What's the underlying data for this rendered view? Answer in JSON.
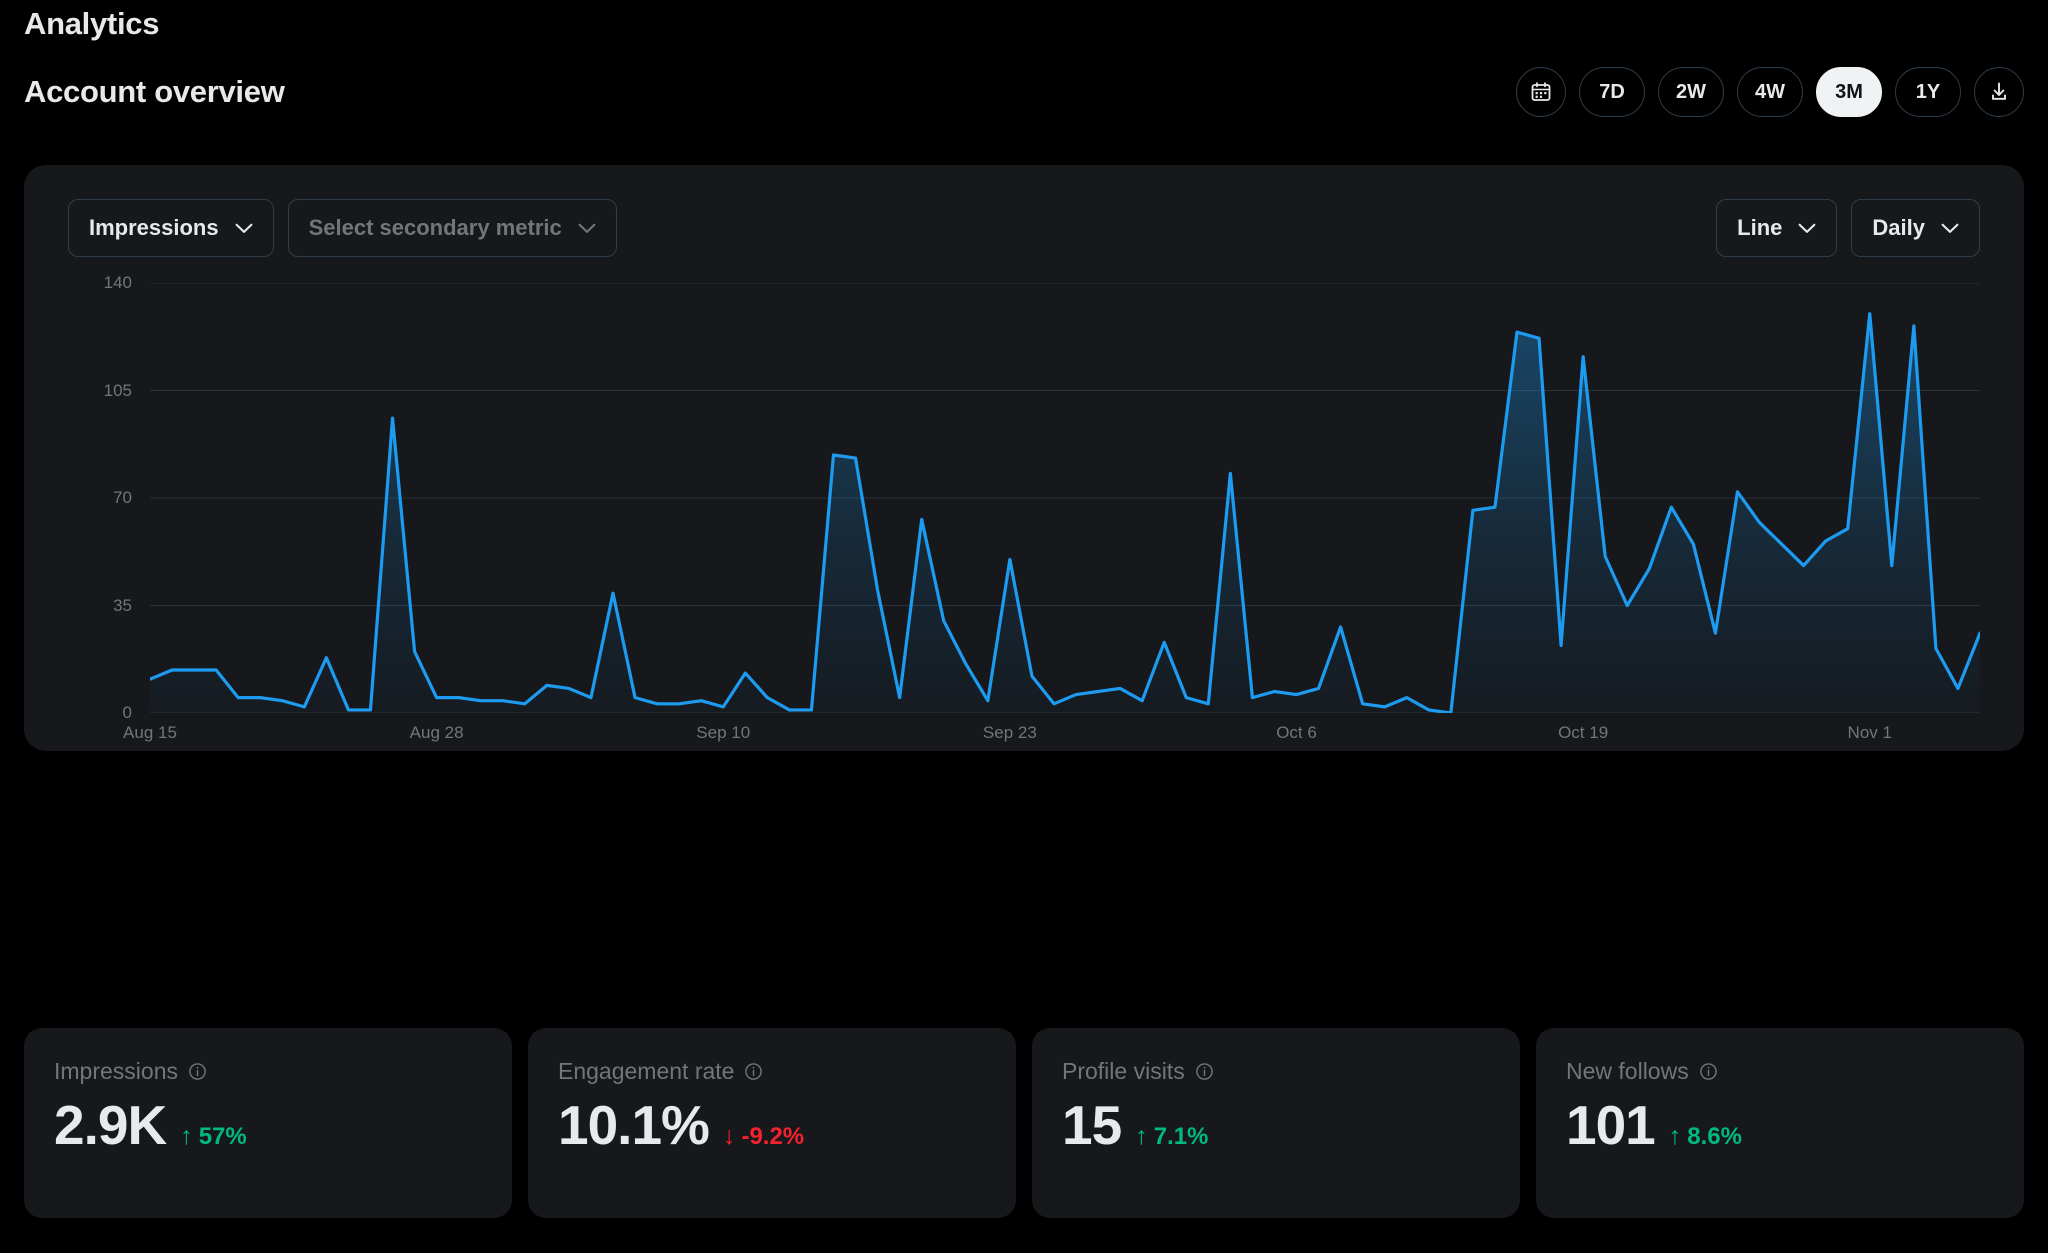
{
  "header": {
    "eyebrow": "Analytics",
    "title": "Account overview",
    "calendar_icon": "calendar-icon",
    "download_icon": "download-icon",
    "ranges": [
      {
        "label": "7D",
        "active": false
      },
      {
        "label": "2W",
        "active": false
      },
      {
        "label": "4W",
        "active": false
      },
      {
        "label": "3M",
        "active": true
      },
      {
        "label": "1Y",
        "active": false
      }
    ]
  },
  "controls": {
    "primary_metric": "Impressions",
    "secondary_metric_placeholder": "Select secondary metric",
    "chart_type": "Line",
    "granularity": "Daily",
    "chevron_icon": "chevron-down-icon"
  },
  "chart_data": {
    "type": "line",
    "title": "Impressions",
    "xlabel": "",
    "ylabel": "",
    "ylim": [
      0,
      140
    ],
    "yticks": [
      0,
      35,
      70,
      105,
      140
    ],
    "grid": true,
    "legend": "none",
    "accent_color": "#1d9bf0",
    "fill": "gradient",
    "x_tick_labels": [
      "Aug 15",
      "Aug 28",
      "Sep 10",
      "Sep 23",
      "Oct 6",
      "Oct 19",
      "Nov 1"
    ],
    "x_tick_indices": [
      0,
      13,
      26,
      39,
      52,
      65,
      78
    ],
    "x": [
      "Aug 15",
      "Aug 16",
      "Aug 17",
      "Aug 18",
      "Aug 19",
      "Aug 20",
      "Aug 21",
      "Aug 22",
      "Aug 23",
      "Aug 24",
      "Aug 25",
      "Aug 26",
      "Aug 27",
      "Aug 28",
      "Aug 29",
      "Aug 30",
      "Aug 31",
      "Sep 1",
      "Sep 2",
      "Sep 3",
      "Sep 4",
      "Sep 5",
      "Sep 6",
      "Sep 7",
      "Sep 8",
      "Sep 9",
      "Sep 10",
      "Sep 11",
      "Sep 12",
      "Sep 13",
      "Sep 14",
      "Sep 15",
      "Sep 16",
      "Sep 17",
      "Sep 18",
      "Sep 19",
      "Sep 20",
      "Sep 21",
      "Sep 22",
      "Sep 23",
      "Sep 24",
      "Sep 25",
      "Sep 26",
      "Sep 27",
      "Sep 28",
      "Sep 29",
      "Sep 30",
      "Oct 1",
      "Oct 2",
      "Oct 3",
      "Oct 4",
      "Oct 5",
      "Oct 6",
      "Oct 7",
      "Oct 8",
      "Oct 9",
      "Oct 10",
      "Oct 11",
      "Oct 12",
      "Oct 13",
      "Oct 14",
      "Oct 15",
      "Oct 16",
      "Oct 17",
      "Oct 18",
      "Oct 19",
      "Oct 20",
      "Oct 21",
      "Oct 22",
      "Oct 23",
      "Oct 24",
      "Oct 25",
      "Oct 26",
      "Oct 27",
      "Oct 28",
      "Oct 29",
      "Oct 30",
      "Oct 31",
      "Nov 1",
      "Nov 2",
      "Nov 3",
      "Nov 4",
      "Nov 5"
    ],
    "values": [
      11,
      14,
      14,
      14,
      5,
      5,
      4,
      2,
      18,
      1,
      1,
      96,
      20,
      5,
      5,
      4,
      4,
      3,
      9,
      8,
      5,
      39,
      5,
      3,
      3,
      4,
      2,
      13,
      5,
      1,
      1,
      84,
      83,
      40,
      5,
      63,
      30,
      16,
      4,
      50,
      12,
      3,
      6,
      7,
      8,
      4,
      23,
      5,
      3,
      78,
      5,
      7,
      6,
      8,
      28,
      3,
      2,
      5,
      1,
      0,
      66,
      67,
      124,
      122,
      22,
      116,
      51,
      35,
      47,
      67,
      55,
      26,
      72,
      62,
      55,
      48,
      56,
      60,
      130,
      48,
      126,
      21,
      8,
      26
    ]
  },
  "cards": [
    {
      "label": "Impressions",
      "value": "2.9K",
      "delta": "57%",
      "direction": "up",
      "arrow": "↑",
      "info_icon": "info-icon"
    },
    {
      "label": "Engagement rate",
      "value": "10.1%",
      "delta": "-9.2%",
      "direction": "down",
      "arrow": "↓",
      "info_icon": "info-icon"
    },
    {
      "label": "Profile visits",
      "value": "15",
      "delta": "7.1%",
      "direction": "up",
      "arrow": "↑",
      "info_icon": "info-icon"
    },
    {
      "label": "New follows",
      "value": "101",
      "delta": "8.6%",
      "direction": "up",
      "arrow": "↑",
      "info_icon": "info-icon"
    }
  ]
}
